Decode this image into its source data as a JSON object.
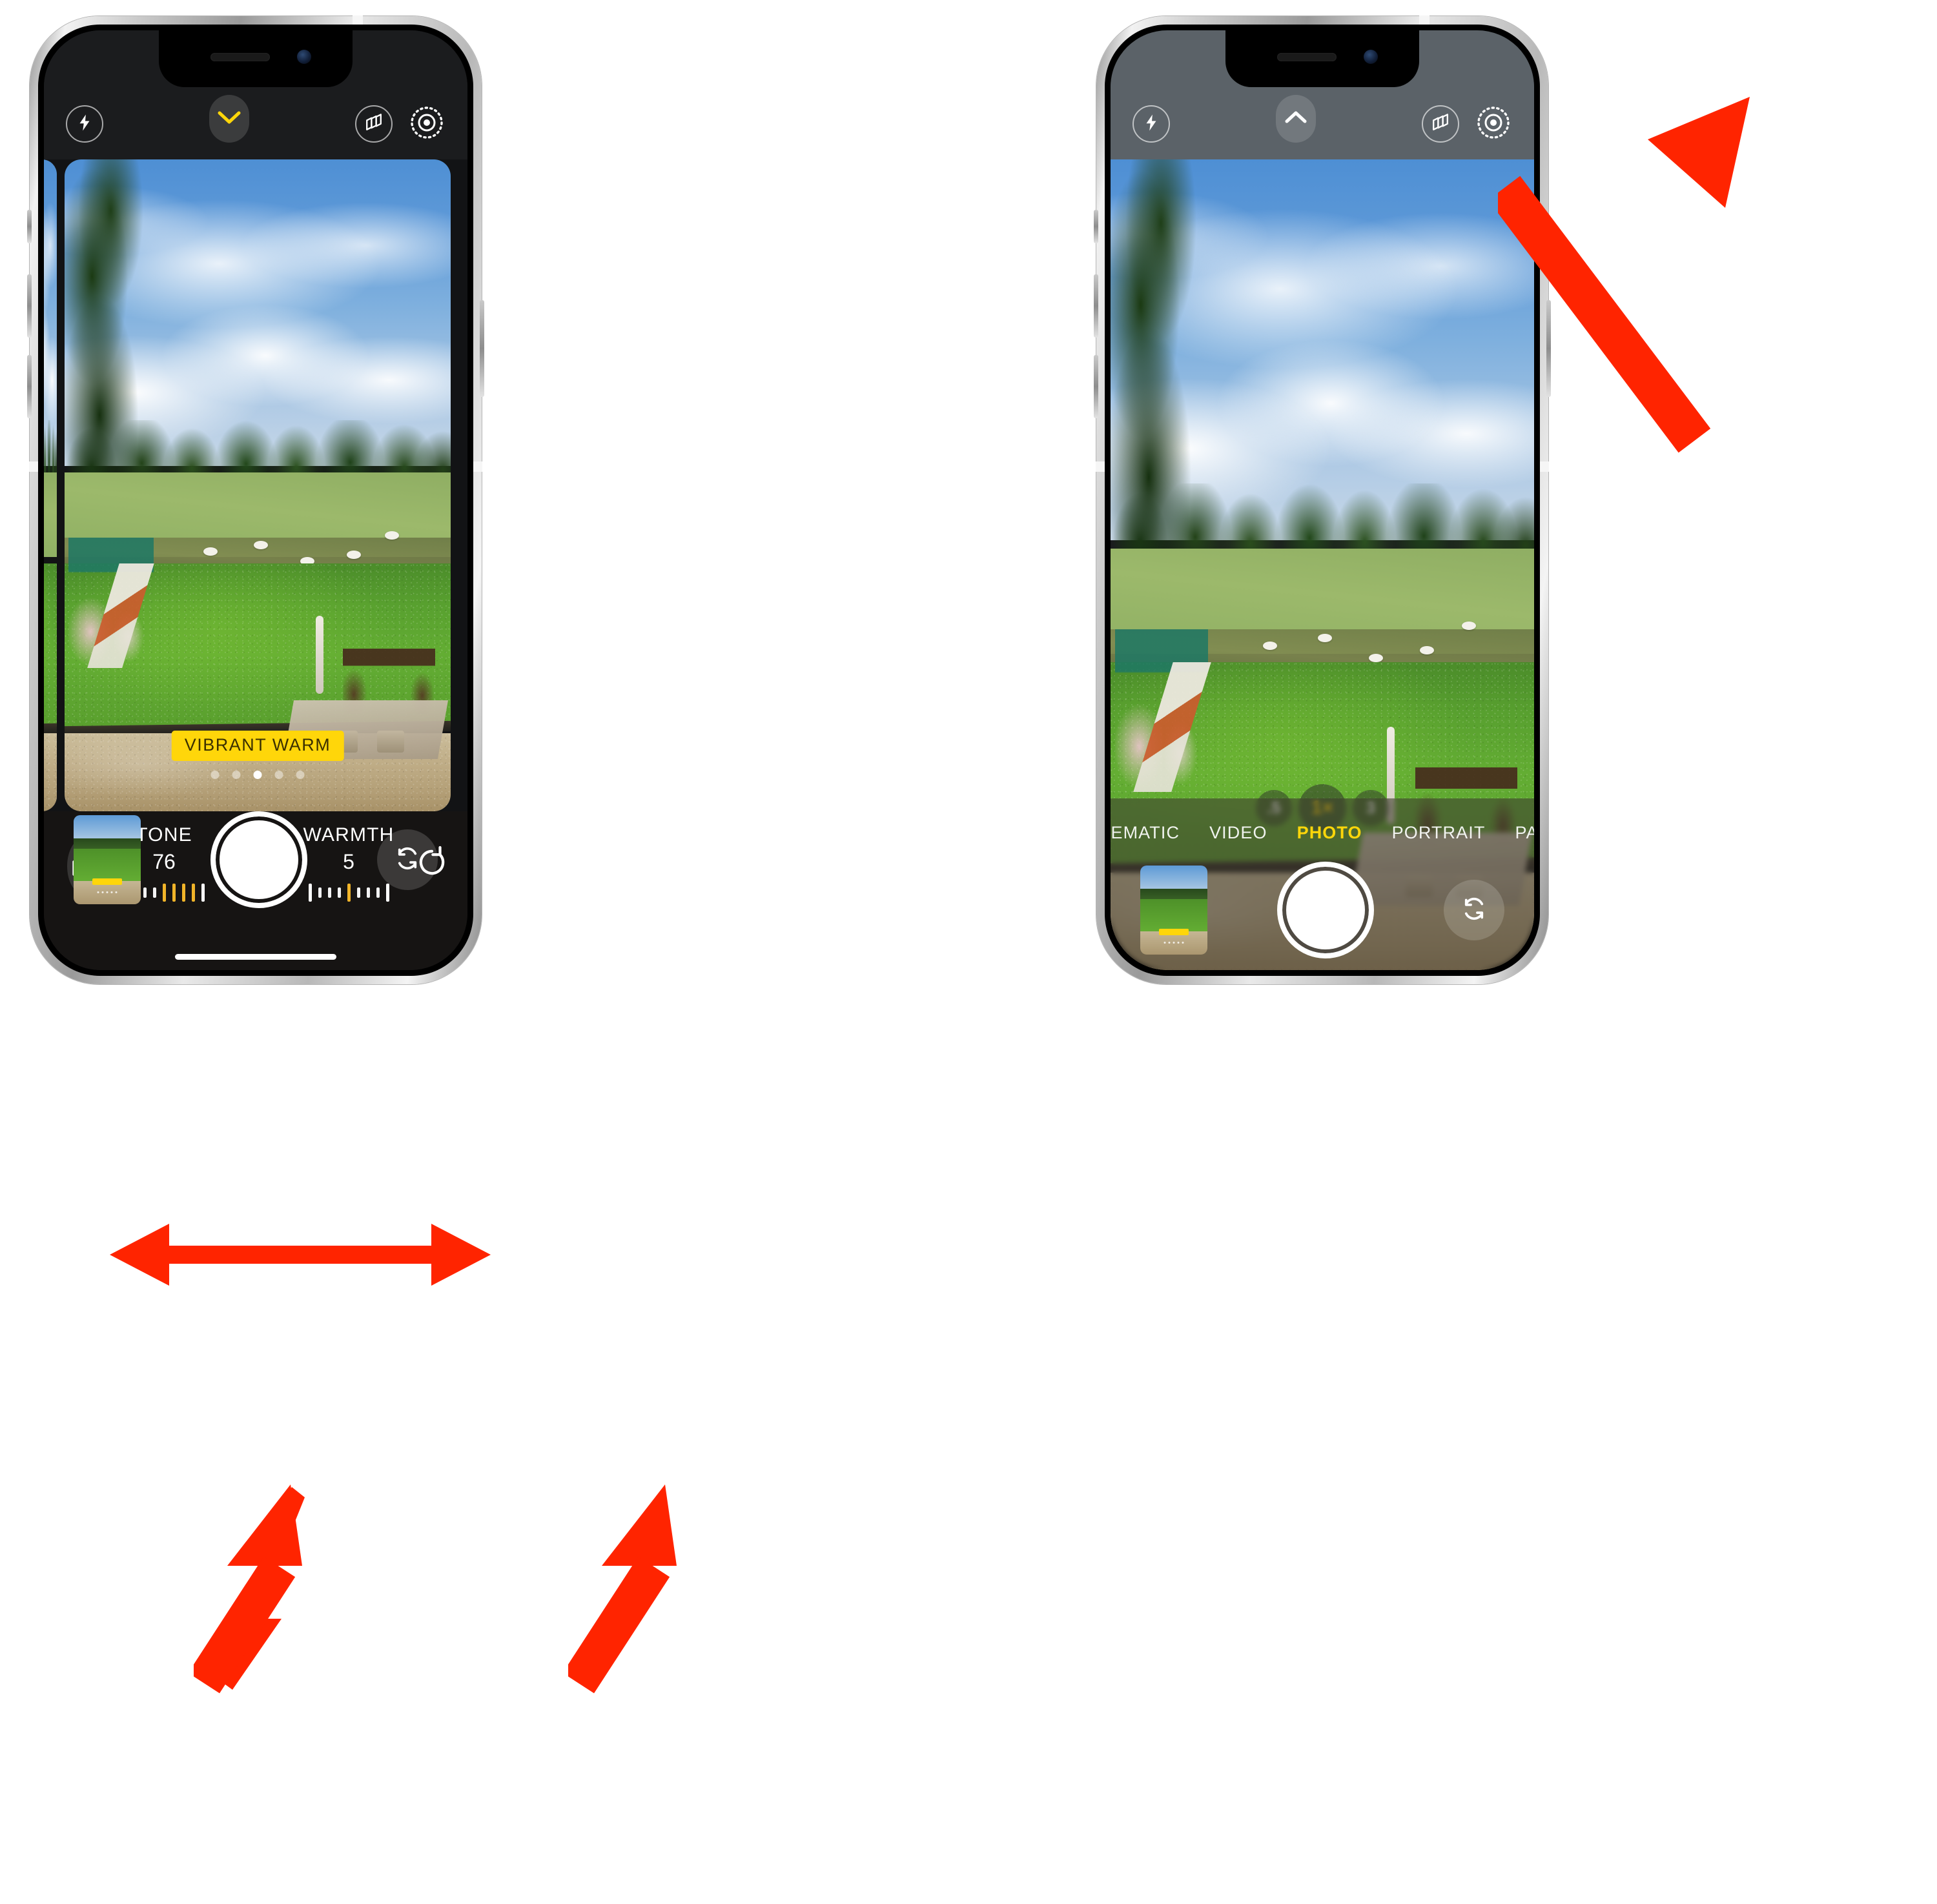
{
  "meta": {
    "app": "Camera",
    "device": "iPhone",
    "accent_yellow": "#ffd60a",
    "annotation_red": "#ff2400",
    "panel_dark": "#161413",
    "panel_grey": "#5b6268"
  },
  "left_phone": {
    "label": "iphone-camera-photographic-styles-adjust",
    "top_bar": {
      "flash_icon": "flash-bolt-icon",
      "chevron_icon": "chevron-down-icon",
      "chevron_state": "expanded",
      "styles_icon": "photographic-styles-icon",
      "live_photo_icon": "live-photo-icon"
    },
    "viewfinder": {
      "style_badge": "VIBRANT WARM",
      "page_dots": 5,
      "active_dot": 3
    },
    "controls": {
      "styles_toggle_icon": "photographic-styles-icon",
      "reset_icon": "reset-arrow-icon",
      "sliders": [
        {
          "label": "TONE",
          "value": "76",
          "ticks": 9,
          "highlight_from": 5,
          "highlight_to": 8
        },
        {
          "label": "WARMTH",
          "value": "5",
          "ticks": 9,
          "highlight_from": 5,
          "highlight_to": 5
        }
      ],
      "thumbnail": "last-photo-thumbnail",
      "shutter": "shutter-button",
      "flip_icon": "camera-flip-icon"
    }
  },
  "right_phone": {
    "label": "iphone-camera-photo-mode",
    "top_bar": {
      "flash_icon": "flash-bolt-icon",
      "chevron_icon": "chevron-up-icon",
      "chevron_state": "collapsed",
      "styles_icon": "photographic-styles-icon",
      "live_photo_icon": "live-photo-icon"
    },
    "viewfinder": {
      "zoom_options": [
        {
          "label": ".5",
          "active": false
        },
        {
          "label": "1×",
          "active": true
        },
        {
          "label": "3",
          "active": false
        }
      ]
    },
    "modes": [
      {
        "label": "CINEMATIC",
        "active": false
      },
      {
        "label": "VIDEO",
        "active": false
      },
      {
        "label": "PHOTO",
        "active": true
      },
      {
        "label": "PORTRAIT",
        "active": false
      },
      {
        "label": "PANO",
        "active": false
      }
    ],
    "controls": {
      "thumbnail": "last-photo-thumbnail",
      "shutter": "shutter-button",
      "flip_icon": "camera-flip-icon"
    }
  },
  "annotations": [
    {
      "name": "double-arrow-swipe-styles",
      "type": "double-arrow",
      "color": "#ff2400"
    },
    {
      "name": "arrow-to-tone-slider",
      "type": "arrow",
      "color": "#ff2400"
    },
    {
      "name": "arrow-to-warmth-slider",
      "type": "arrow",
      "color": "#ff2400"
    },
    {
      "name": "arrow-to-styles-button",
      "type": "arrow",
      "color": "#ff2400"
    }
  ]
}
